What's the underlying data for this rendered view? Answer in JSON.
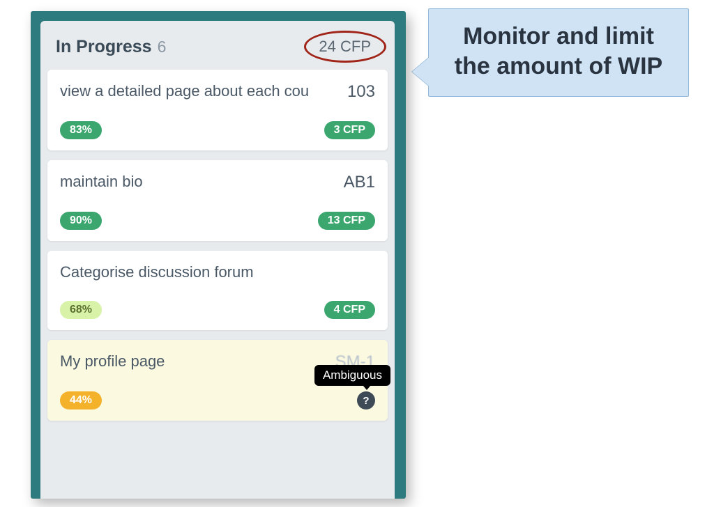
{
  "column": {
    "title": "In Progress",
    "count": "6",
    "cfp_total": "24 CFP"
  },
  "cards": [
    {
      "title": "view a detailed page about each cou",
      "id": "103",
      "pct": "83%",
      "pct_class": "pct-green",
      "cfp": "3 CFP",
      "highlight": false,
      "has_help": false
    },
    {
      "title": "maintain bio",
      "id": "AB1",
      "pct": "90%",
      "pct_class": "pct-green",
      "cfp": "13 CFP",
      "highlight": false,
      "has_help": false
    },
    {
      "title": "Categorise discussion forum",
      "id": "",
      "pct": "68%",
      "pct_class": "pct-lime",
      "cfp": "4 CFP",
      "highlight": false,
      "has_help": false
    },
    {
      "title": "My profile page",
      "id": "SM-1",
      "pct": "44%",
      "pct_class": "pct-amber",
      "cfp": "",
      "highlight": true,
      "has_help": true,
      "tooltip": "Ambiguous"
    }
  ],
  "callout": {
    "text": "Monitor and limit the amount of WIP"
  }
}
